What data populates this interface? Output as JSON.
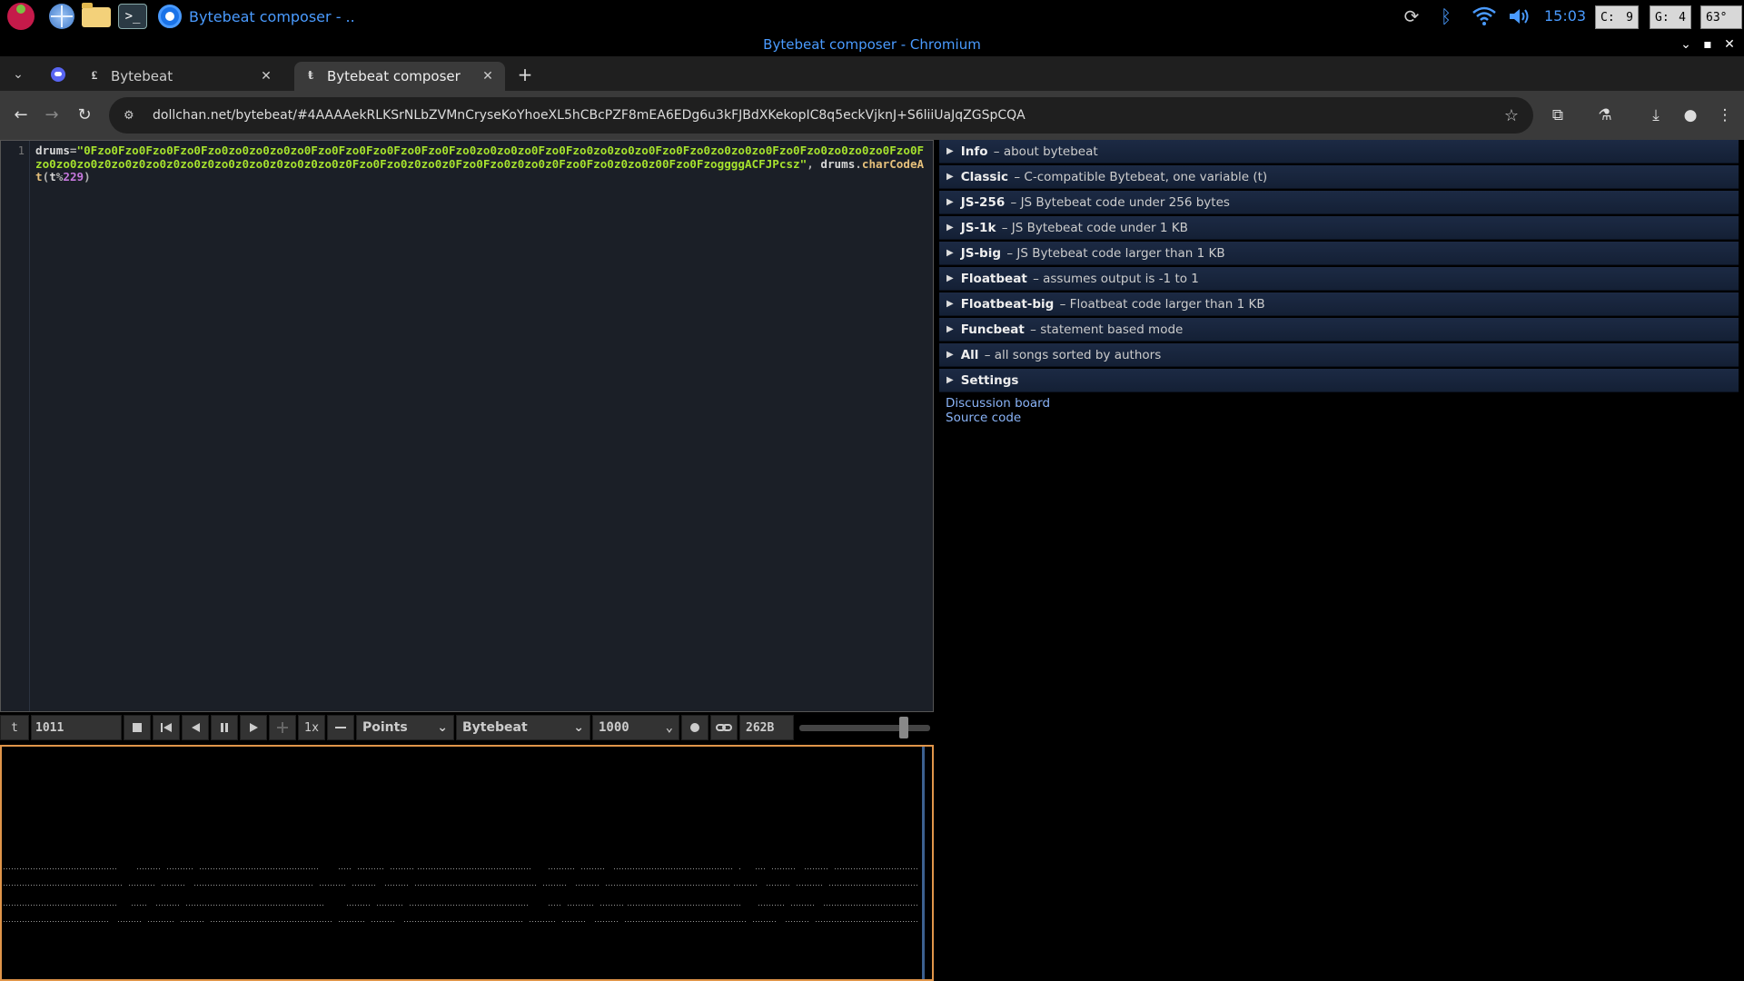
{
  "taskbar": {
    "terminal_glyph": ">_",
    "active_window": "Bytebeat composer - ..",
    "clock": "15:03",
    "cpu": {
      "label": "C:",
      "value": "9"
    },
    "gpu": {
      "label": "G:",
      "value": "4"
    },
    "temperature": "63°"
  },
  "window": {
    "title": "Bytebeat composer - Chromium"
  },
  "tabs": [
    {
      "label": "Bytebeat",
      "favicon": "₤"
    },
    {
      "label": "Bytebeat composer",
      "favicon": "ŧ"
    }
  ],
  "omnibox": {
    "url": "dollchan.net/bytebeat/#4AAAAekRLKSrNLbZVMnCryseKoYhoeXL5hCBcPZF8mEA6EDg6u3kFJBdXKekopIC8q5eckVjknJ+S6liiUaJqZGSpCQA"
  },
  "editor": {
    "line_number": "1",
    "code": {
      "var_name": "drums",
      "assign": "=",
      "string": "\"0Fzo0Fzo0Fzo0Fzo0Fzo0zo0zo0zo0zo0Fzo0Fzo0Fzo0Fzo0Fzo0Fzo0zo0zo0zo0Fzo0Fzo0zo0zo0zo0Fzo0Fzo0zo0zo0zo0Fzo0Fzo0zo0zo0zo0Fzo0Fzo0zo0zo0z0zo0z0zo0z0zo0z0zo0z0zo0z0zo0z0zo0z0Fzo0Fzo0z0zo0z0Fzo0Fzo0z0zo0z0Fzo0Fzo0z0zo0z00Fzo0FzoggggACFJPcsz\"",
      "sep": ", ",
      "obj": "drums",
      "dot": ".",
      "method": "charCodeAt",
      "open": "(",
      "arg": "t",
      "mod": "%",
      "num": "229",
      "close": ")"
    }
  },
  "controls": {
    "time_label": "t",
    "time_value": "1011",
    "speed": "1x",
    "draw_mode": "Points",
    "mode": "Bytebeat",
    "sample_rate": "1000",
    "code_size": "262B",
    "volume_fraction": 0.82
  },
  "library": {
    "sections": [
      {
        "name": "Info",
        "desc": "– about bytebeat"
      },
      {
        "name": "Classic",
        "desc": "– C-compatible Bytebeat, one variable (t)"
      },
      {
        "name": "JS-256",
        "desc": "– JS Bytebeat code under 256 bytes"
      },
      {
        "name": "JS-1k",
        "desc": "– JS Bytebeat code under 1 KB"
      },
      {
        "name": "JS-big",
        "desc": "– JS Bytebeat code larger than 1 KB"
      },
      {
        "name": "Floatbeat",
        "desc": "– assumes output is -1 to 1"
      },
      {
        "name": "Floatbeat-big",
        "desc": "– Floatbeat code larger than 1 KB"
      },
      {
        "name": "Funcbeat",
        "desc": "– statement based mode"
      },
      {
        "name": "All",
        "desc": "– all songs sorted by authors"
      },
      {
        "name": "Settings",
        "desc": ""
      }
    ],
    "links": {
      "discussion": "Discussion board",
      "source": "Source code"
    }
  },
  "colors": {
    "accent": "#4a9bff",
    "scope_border": "#e0954a",
    "code_string": "#a6e22e",
    "code_number": "#c678dd"
  }
}
